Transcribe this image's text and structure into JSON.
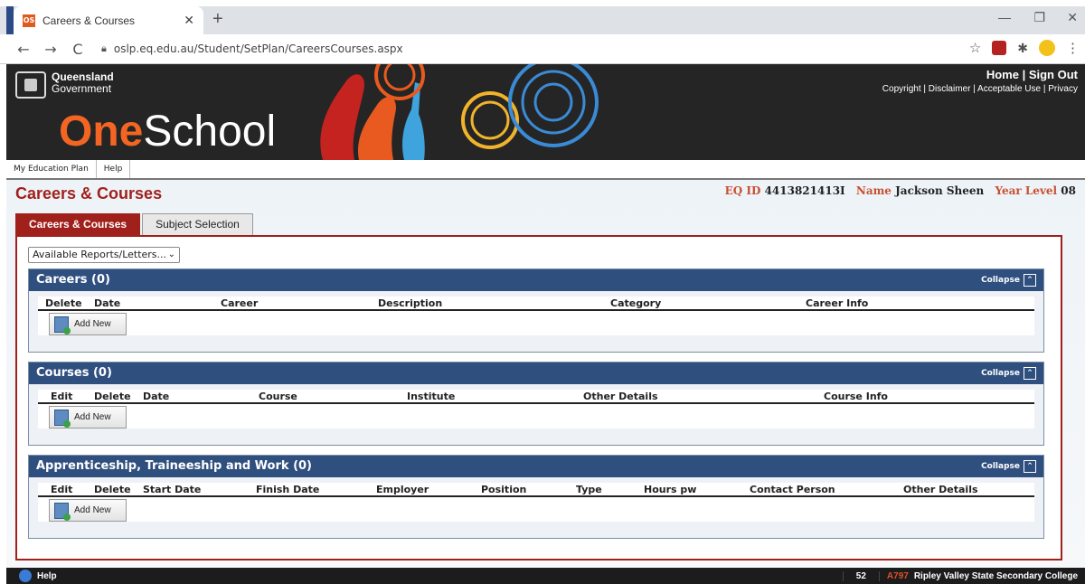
{
  "browser": {
    "tab_title": "Careers & Courses",
    "favicon_text": "OS",
    "new_tab": "+",
    "url": "oslp.eq.edu.au/Student/SetPlan/CareersCourses.aspx",
    "win_min": "—",
    "win_max": "❐",
    "win_close": "✕",
    "tab_close": "✕",
    "back": "←",
    "forward": "→",
    "reload": "C",
    "star": "☆"
  },
  "banner": {
    "gov_line1": "Queensland",
    "gov_line2": "Government",
    "logo_one": "One",
    "logo_school": "School",
    "link_home": "Home",
    "link_sep": "|",
    "link_signout": "Sign Out",
    "footer_links": "Copyright | Disclaimer | Acceptable Use | Privacy"
  },
  "menu": {
    "items": [
      "My Education Plan",
      "Help"
    ]
  },
  "page": {
    "title": "Careers & Courses",
    "eq_id_label": "EQ ID",
    "eq_id_value": "4413821413I",
    "name_label": "Name",
    "name_value": "Jackson Sheen",
    "year_label": "Year Level",
    "year_value": "08",
    "tabs": [
      "Careers & Courses",
      "Subject Selection"
    ],
    "reports_select": "Available Reports/Letters...",
    "collapse_label": "Collapse",
    "collapse_icon": "⌃",
    "add_new_label": "Add New"
  },
  "sections": {
    "careers": {
      "title": "Careers (0)",
      "columns": [
        "Delete",
        "Date",
        "Career",
        "Description",
        "Category",
        "Career Info"
      ]
    },
    "courses": {
      "title": "Courses (0)",
      "columns": [
        "Edit",
        "Delete",
        "Date",
        "Course",
        "Institute",
        "Other Details",
        "Course Info"
      ]
    },
    "work": {
      "title": "Apprenticeship, Traineeship and Work (0)",
      "columns": [
        "Edit",
        "Delete",
        "Start Date",
        "Finish Date",
        "Employer",
        "Position",
        "Type",
        "Hours pw",
        "Contact Person",
        "Other Details"
      ]
    }
  },
  "statusbar": {
    "help": "Help",
    "count": "52",
    "school_code": "A797",
    "school_name": "Ripley Valley State Secondary College"
  },
  "colors": {
    "brand_red": "#a0211b",
    "section_blue": "#2f4f7f",
    "logo_orange": "#f26522"
  }
}
